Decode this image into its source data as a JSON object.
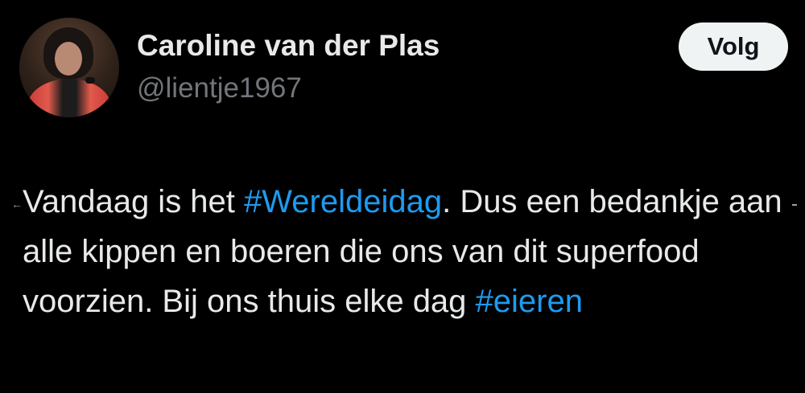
{
  "author": {
    "name": "Caroline van der Plas",
    "handle": "@lientje1967"
  },
  "follow_button": {
    "label": "Volg"
  },
  "tweet": {
    "text_1": "Vandaag is het ",
    "hashtag_1": "#Wereldeidag",
    "text_2": ". Dus een bedankje aan alle kippen en boeren die ons van dit superfood voorzien. Bij ons thuis elke dag ",
    "hashtag_2": "#eieren"
  },
  "colors": {
    "background": "#000000",
    "text": "#e7e9ea",
    "secondary_text": "#71767b",
    "link": "#1d9bf0",
    "button_bg": "#eff3f4"
  }
}
